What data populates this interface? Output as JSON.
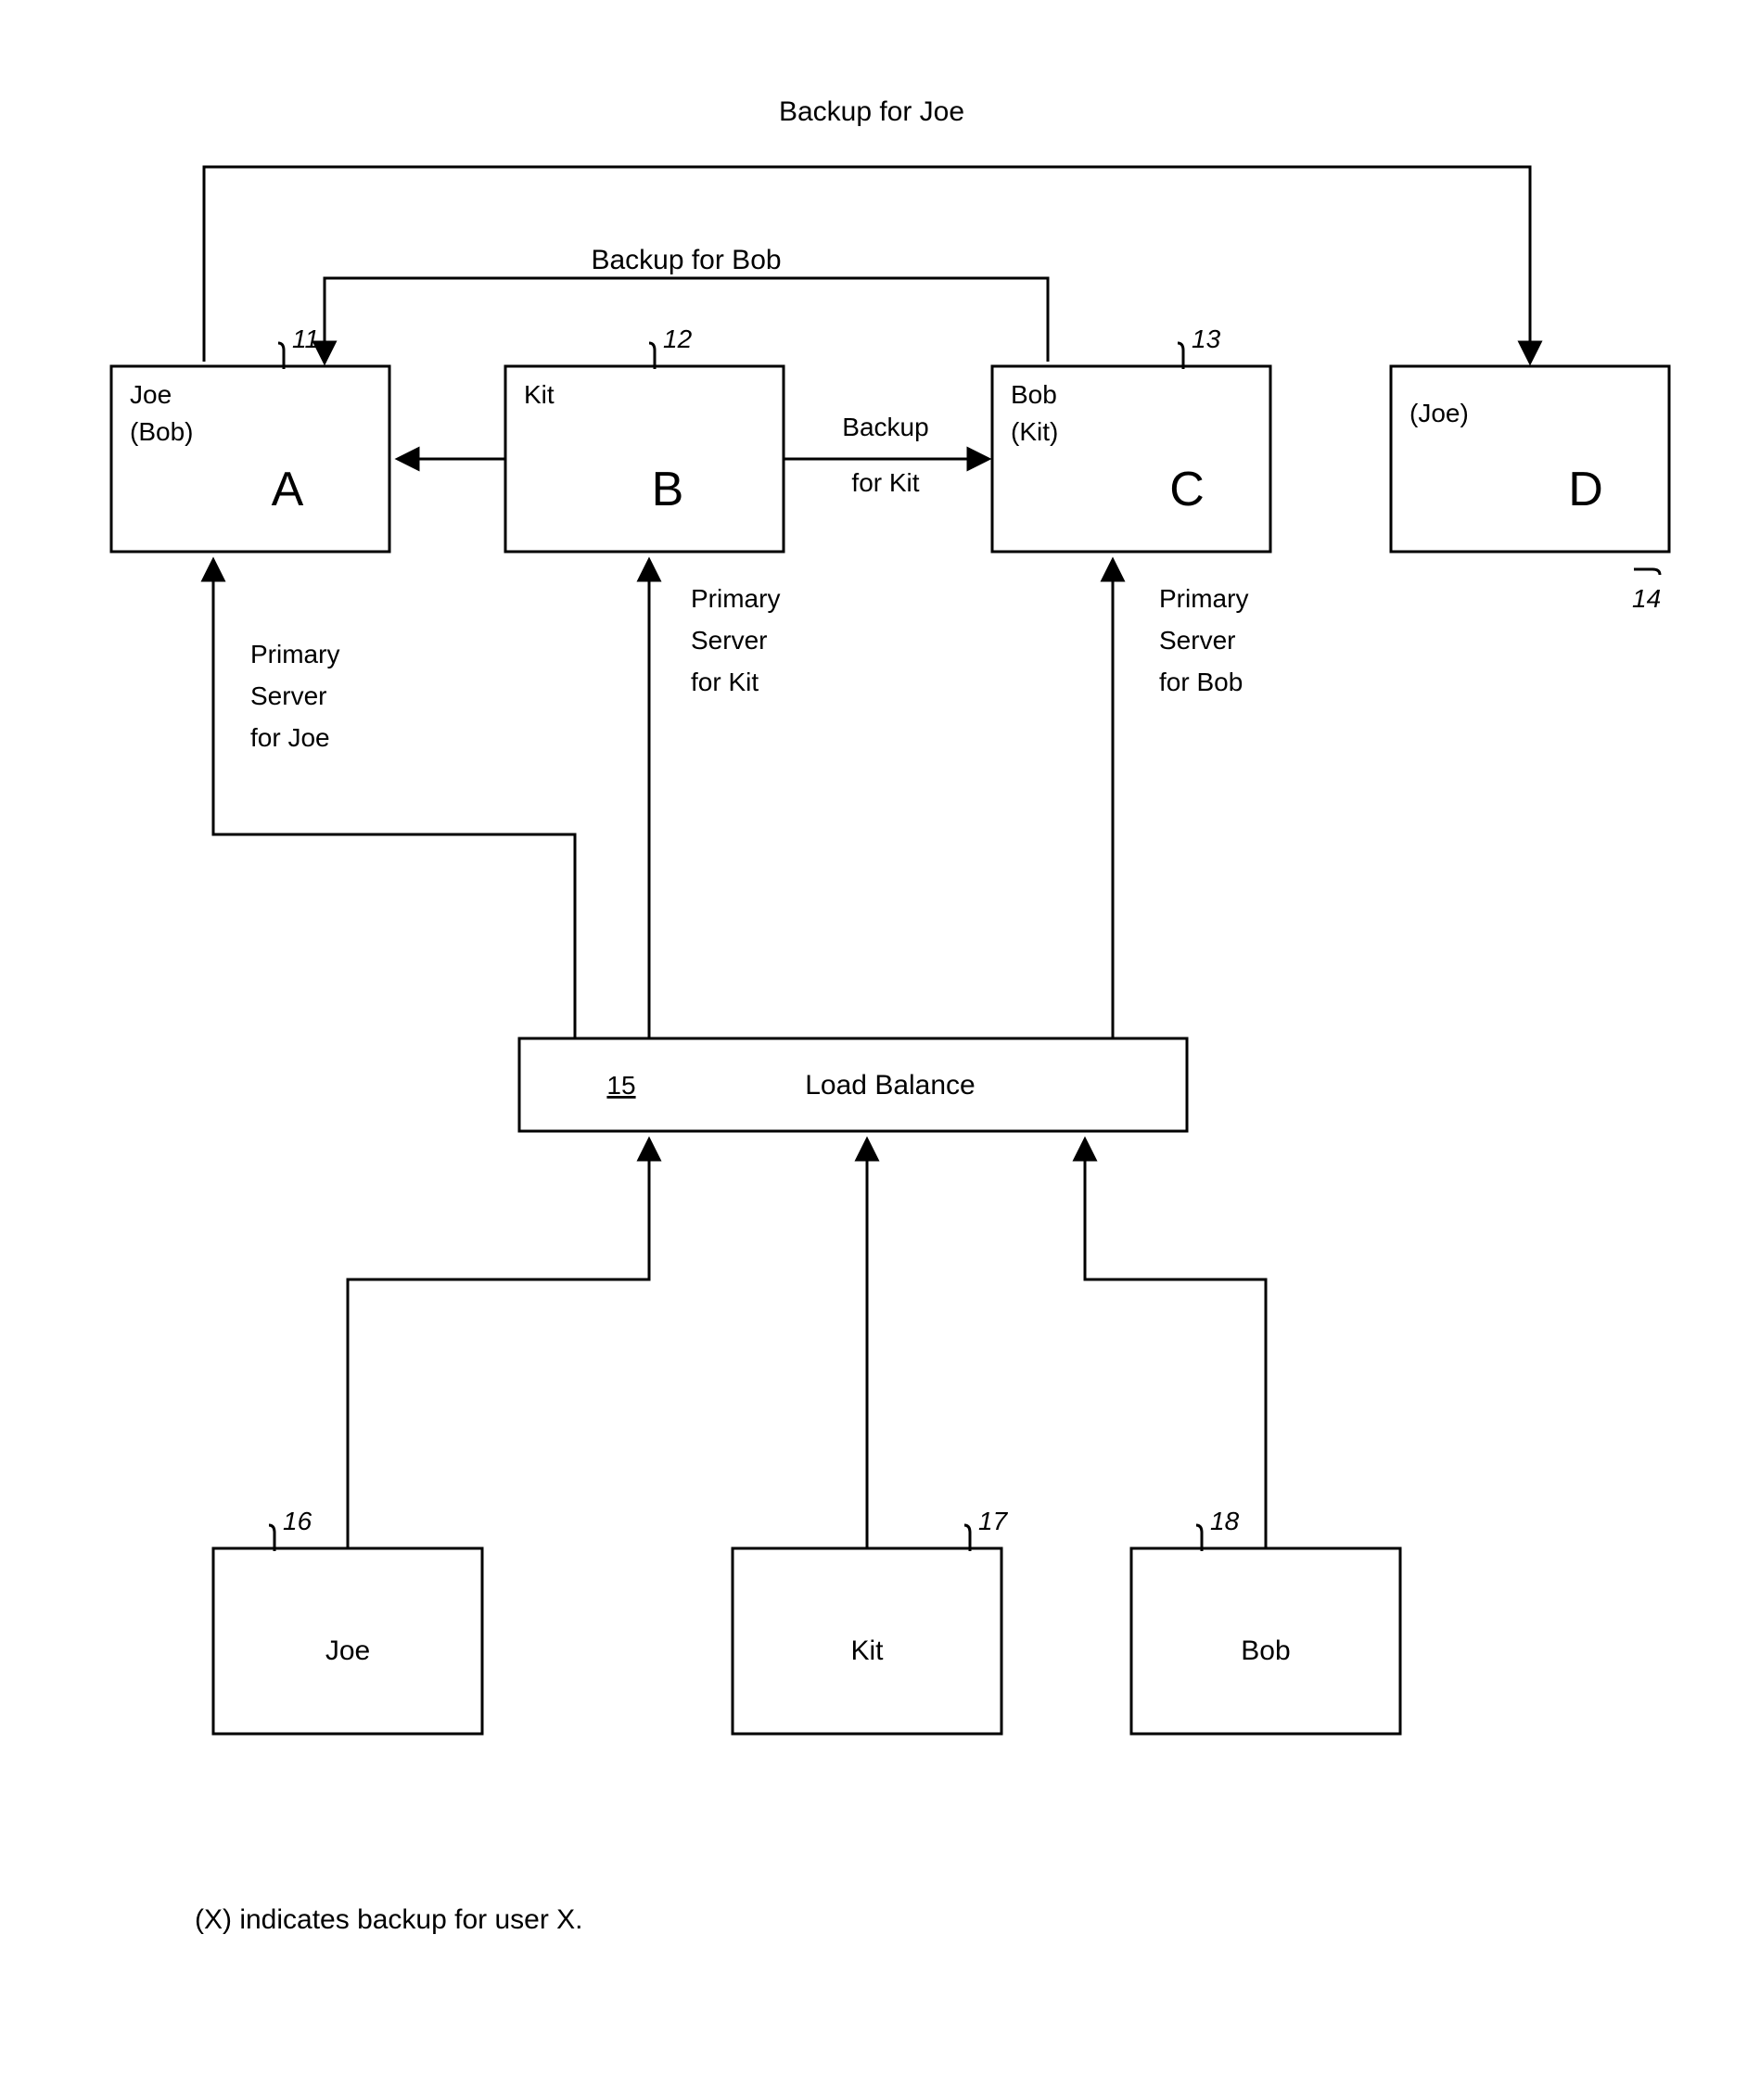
{
  "labels": {
    "backupJoe": "Backup for Joe",
    "backupBob": "Backup for Bob",
    "backupKitLine1": "Backup",
    "backupKitLine2": "for Kit",
    "primaryJoe1": "Primary",
    "primaryJoe2": "Server",
    "primaryJoe3": "for Joe",
    "primaryKit1": "Primary",
    "primaryKit2": "Server",
    "primaryKit3": "for Kit",
    "primaryBob1": "Primary",
    "primaryBob2": "Server",
    "primaryBob3": "for Bob",
    "legend": "(X)  indicates  backup  for  user  X."
  },
  "servers": {
    "A": {
      "letter": "A",
      "user": "Joe",
      "backup": "(Bob)",
      "ref": "11"
    },
    "B": {
      "letter": "B",
      "user": "Kit",
      "backup": "",
      "ref": "12"
    },
    "C": {
      "letter": "C",
      "user": "Bob",
      "backup": "(Kit)",
      "ref": "13"
    },
    "D": {
      "letter": "D",
      "user": "",
      "backup": "(Joe)",
      "ref": "14"
    }
  },
  "loadBalance": {
    "ref": "15",
    "label": "Load Balance"
  },
  "clients": {
    "joe": {
      "name": "Joe",
      "ref": "16"
    },
    "kit": {
      "name": "Kit",
      "ref": "17"
    },
    "bob": {
      "name": "Bob",
      "ref": "18"
    }
  }
}
